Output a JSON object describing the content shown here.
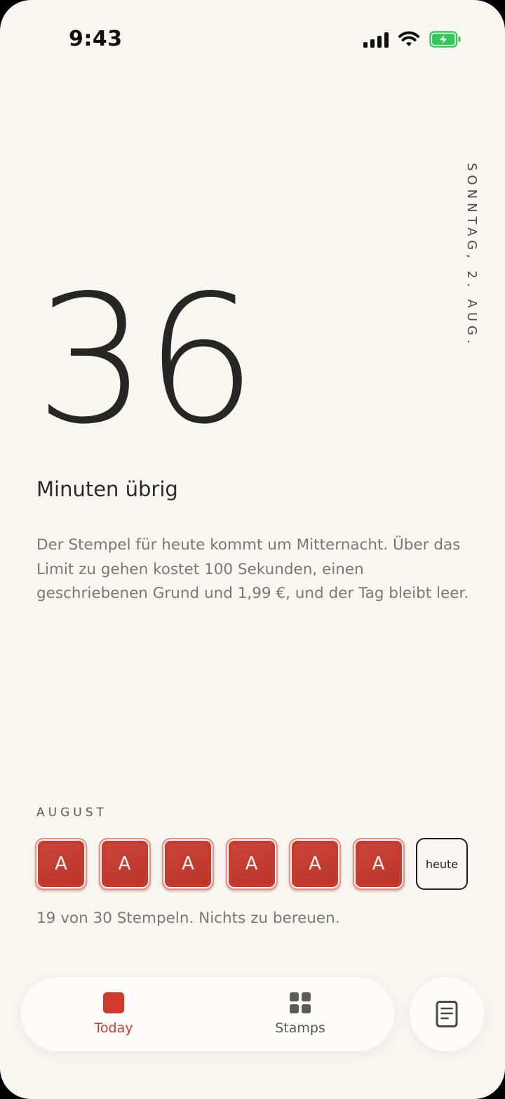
{
  "status_bar": {
    "time": "9:43",
    "icons": [
      "cellular-signal-icon",
      "wifi-icon",
      "battery-charging-icon"
    ],
    "battery_color": "#34c759"
  },
  "header": {
    "date_vertical": "SONNTAG, 2. AUG."
  },
  "main": {
    "minutes_remaining": "36",
    "minutes_label": "Minuten übrig",
    "description": "Der Stempel für heute kommt um Mitternacht. Über das Limit zu gehen kostet 100 Sekunden, einen geschriebenen Grund und 1,99 €, und der Tag bleibt leer."
  },
  "calendar": {
    "month": "AUGUST",
    "stamps": [
      {
        "label": "A"
      },
      {
        "label": "A"
      },
      {
        "label": "A"
      },
      {
        "label": "A"
      },
      {
        "label": "A"
      },
      {
        "label": "A"
      }
    ],
    "today_label": "heute",
    "summary": "19 von 30 Stempeln. Nichts zu bereuen."
  },
  "tabbar": {
    "tabs": [
      {
        "label": "Today",
        "icon": "today-square-icon",
        "active": true
      },
      {
        "label": "Stamps",
        "icon": "grid-icon",
        "active": false
      }
    ],
    "side_button_icon": "notes-icon"
  },
  "colors": {
    "accent": "#d03a2a",
    "stamp_red": "#c93a2d",
    "background": "#f8f6f1"
  }
}
